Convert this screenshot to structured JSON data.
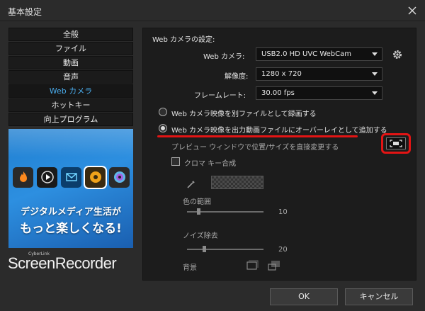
{
  "window": {
    "title": "基本設定",
    "close_label": "✕"
  },
  "sidebar": {
    "items": [
      {
        "label": "全般",
        "active": false
      },
      {
        "label": "ファイル",
        "active": false
      },
      {
        "label": "動画",
        "active": false
      },
      {
        "label": "音声",
        "active": false
      },
      {
        "label": "Web カメラ",
        "active": true
      },
      {
        "label": "ホットキー",
        "active": false
      },
      {
        "label": "向上プログラム",
        "active": false
      }
    ]
  },
  "promo": {
    "line1": "デジタルメディア生活が",
    "line2": "もっと楽しくなる!",
    "icons": [
      "flame-icon",
      "play-icon",
      "envelope-icon",
      "film-reel-icon",
      "disc-icon"
    ]
  },
  "brand": {
    "small": "CyberLink",
    "name": "ScreenRecorder"
  },
  "webcam": {
    "section_title": "Web カメラの設定:",
    "camera_label": "Web カメラ:",
    "camera_value": "USB2.0 HD UVC WebCam",
    "resolution_label": "解像度:",
    "resolution_value": "1280 x 720",
    "framerate_label": "フレームレート:",
    "framerate_value": "30.00 fps",
    "radio_separate": "Web カメラ映像を別ファイルとして録画する",
    "radio_overlay": "Web カメラ映像を出力動画ファイルにオーバーレイとして追加する",
    "selected_radio": "overlay",
    "preview_label": "プレビュー ウィンドウで位置/サイズを直接変更する",
    "chroma_label": "クロマ キー合成",
    "chroma_checked": false,
    "color_range_label": "色の範囲",
    "color_range_value": "10",
    "color_range_level": 0.13,
    "noise_label": "ノイズ除去",
    "noise_value": "20",
    "noise_level": 0.2,
    "background_label": "背景"
  },
  "footer": {
    "ok_label": "OK",
    "cancel_label": "キャンセル"
  },
  "colors": {
    "accent_blue": "#49a9e8",
    "highlight_red": "#e31414"
  }
}
